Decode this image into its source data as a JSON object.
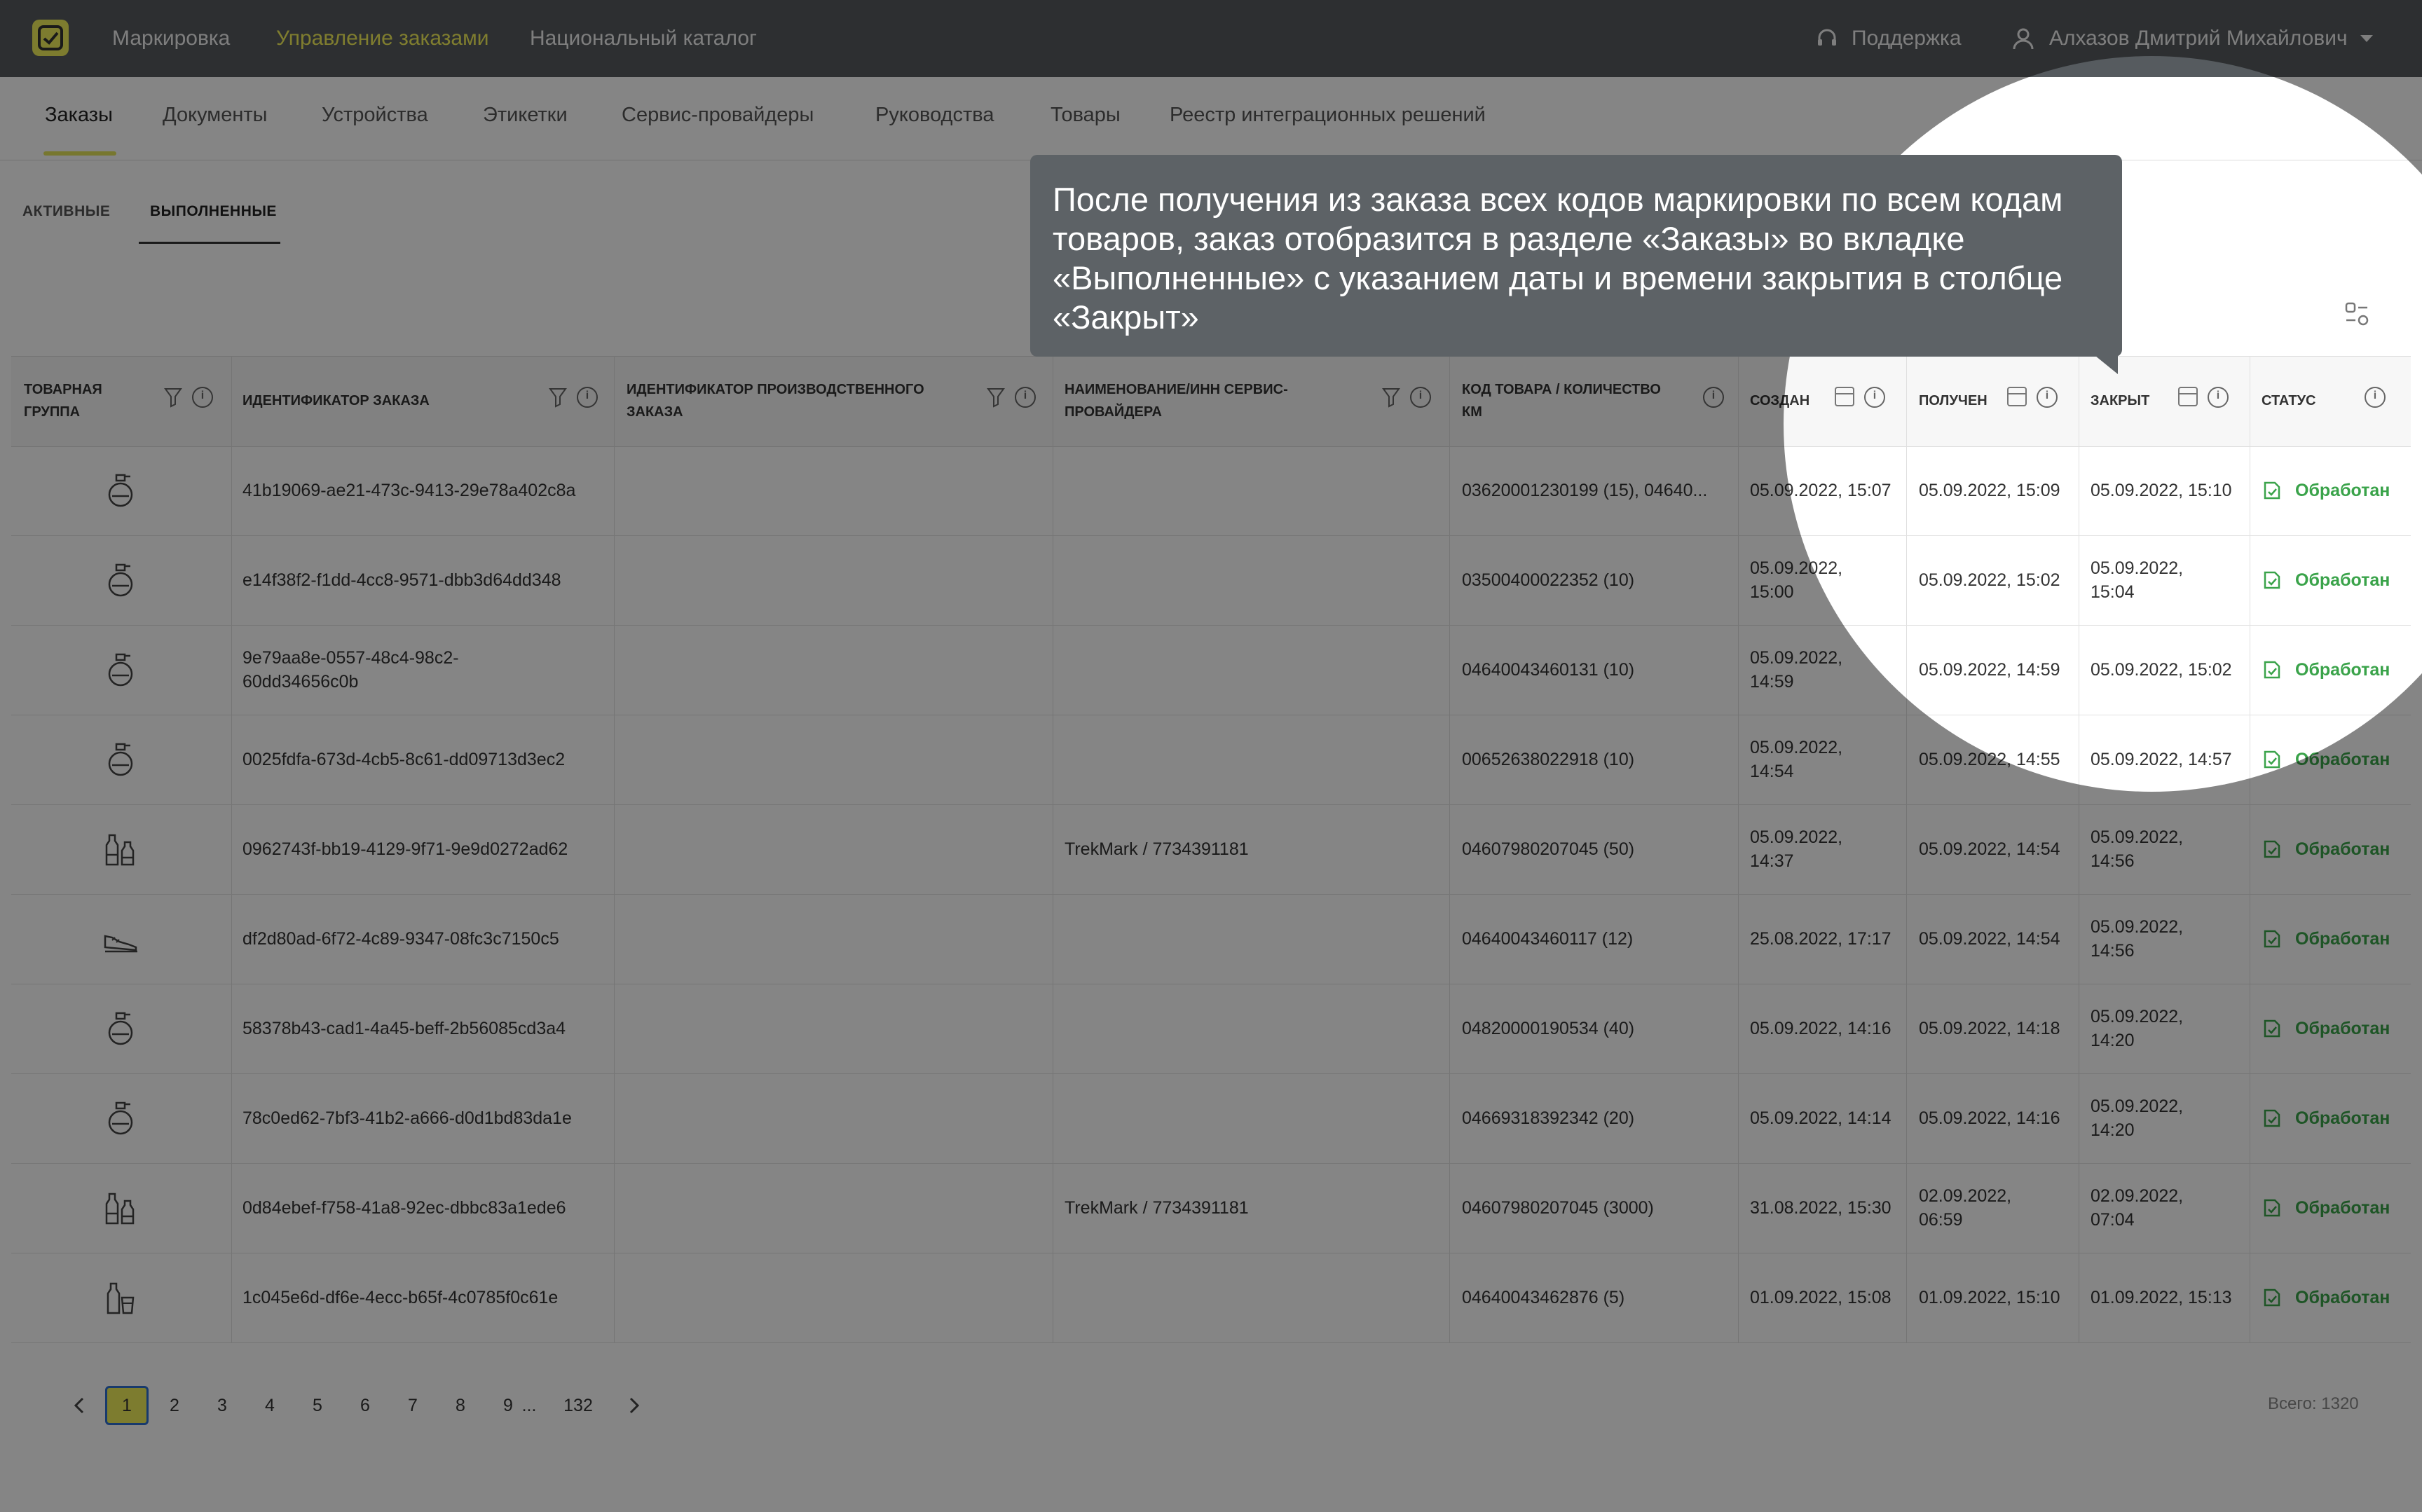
{
  "topbar": {
    "nav": [
      "Маркировка",
      "Управление заказами",
      "Национальный каталог"
    ],
    "support": "Поддержка",
    "user": "Алхазов Дмитрий Михайлович",
    "active_color": "#f3f05a"
  },
  "secnav": [
    "Заказы",
    "Документы",
    "Устройства",
    "Этикетки",
    "Сервис-провайдеры",
    "Руководства",
    "Товары",
    "Реестр интеграционных решений"
  ],
  "subtabs": [
    "АКТИВНЫЕ",
    "ВЫПОЛНЕННЫЕ"
  ],
  "tooltip": "После получения из заказа всех кодов маркировки по всем кодам товаров, заказ отобразится в разделе «Заказы» во вкладке «Выполненные» с указанием даты и времени закрытия в столбце «Закрыт»",
  "table": {
    "headers": {
      "group": [
        "ТОВАРНАЯ",
        "ГРУППА"
      ],
      "order_id": "ИДЕНТИФИКАТОР ЗАКАЗА",
      "prod_id": [
        "ИДЕНТИФИКАТОР ПРОИЗВОДСТВЕННОГО",
        "ЗАКАЗА"
      ],
      "provider": [
        "НАИМЕНОВАНИЕ/ИНН СЕРВИС-",
        "ПРОВАЙДЕРА"
      ],
      "code": [
        "КОД ТОВАРА / КОЛИЧЕСТВО",
        "КМ"
      ],
      "created": "СОЗДАН",
      "received": "ПОЛУЧЕН",
      "closed": "ЗАКРЫТ",
      "status": "СТАТУС"
    },
    "rows": [
      {
        "icon": "perfume-icon",
        "id": [
          "41b19069-ae21-473c-9413-29e78a402c8a"
        ],
        "provider": "",
        "code": "03620001230199 (15), 04640...",
        "created": [
          "05.09.2022, 15:07"
        ],
        "received": [
          "05.09.2022, 15:09"
        ],
        "closed": [
          "05.09.2022, 15:10"
        ],
        "status": "Обработан"
      },
      {
        "icon": "perfume-icon",
        "id": [
          "e14f38f2-f1dd-4cc8-9571-dbb3d64dd348"
        ],
        "provider": "",
        "code": "03500400022352 (10)",
        "created": [
          "05.09.2022,",
          "15:00"
        ],
        "received": [
          "05.09.2022, 15:02"
        ],
        "closed": [
          "05.09.2022,",
          "15:04"
        ],
        "status": "Обработан"
      },
      {
        "icon": "perfume-icon",
        "id": [
          "9e79aa8e-0557-48c4-98c2-",
          "60dd34656c0b"
        ],
        "provider": "",
        "code": "04640043460131 (10)",
        "created": [
          "05.09.2022,",
          "14:59"
        ],
        "received": [
          "05.09.2022, 14:59"
        ],
        "closed": [
          "05.09.2022, 15:02"
        ],
        "status": "Обработан"
      },
      {
        "icon": "perfume-icon",
        "id": [
          "0025fdfa-673d-4cb5-8c61-dd09713d3ec2"
        ],
        "provider": "",
        "code": "00652638022918 (10)",
        "created": [
          "05.09.2022,",
          "14:54"
        ],
        "received": [
          "05.09.2022, 14:55"
        ],
        "closed": [
          "05.09.2022, 14:57"
        ],
        "status": "Обработан"
      },
      {
        "icon": "bottles-icon",
        "id": [
          "0962743f-bb19-4129-9f71-9e9d0272ad62"
        ],
        "provider": "TrekMark / 7734391181",
        "code": "04607980207045 (50)",
        "created": [
          "05.09.2022,",
          "14:37"
        ],
        "received": [
          "05.09.2022, 14:54"
        ],
        "closed": [
          "05.09.2022,",
          "14:56"
        ],
        "status": "Обработан"
      },
      {
        "icon": "shoe-icon",
        "id": [
          "df2d80ad-6f72-4c89-9347-08fc3c7150c5"
        ],
        "provider": "",
        "code": "04640043460117 (12)",
        "created": [
          "25.08.2022, 17:17"
        ],
        "received": [
          "05.09.2022, 14:54"
        ],
        "closed": [
          "05.09.2022,",
          "14:56"
        ],
        "status": "Обработан"
      },
      {
        "icon": "perfume-icon",
        "id": [
          "58378b43-cad1-4a45-beff-2b56085cd3a4"
        ],
        "provider": "",
        "code": "04820000190534 (40)",
        "created": [
          "05.09.2022, 14:16"
        ],
        "received": [
          "05.09.2022, 14:18"
        ],
        "closed": [
          "05.09.2022,",
          "14:20"
        ],
        "status": "Обработан"
      },
      {
        "icon": "perfume-icon",
        "id": [
          "78c0ed62-7bf3-41b2-a666-d0d1bd83da1e"
        ],
        "provider": "",
        "code": "04669318392342 (20)",
        "created": [
          "05.09.2022, 14:14"
        ],
        "received": [
          "05.09.2022, 14:16"
        ],
        "closed": [
          "05.09.2022,",
          "14:20"
        ],
        "status": "Обработан"
      },
      {
        "icon": "bottles-icon",
        "id": [
          "0d84ebef-f758-41a8-92ec-dbbc83a1ede6"
        ],
        "provider": "TrekMark / 7734391181",
        "code": "04607980207045 (3000)",
        "created": [
          "31.08.2022, 15:30"
        ],
        "received": [
          "02.09.2022,",
          "06:59"
        ],
        "closed": [
          "02.09.2022,",
          "07:04"
        ],
        "status": "Обработан"
      },
      {
        "icon": "drinks-icon",
        "id": [
          "1c045e6d-df6e-4ecc-b65f-4c0785f0c61e"
        ],
        "provider": "",
        "code": "04640043462876 (5)",
        "created": [
          "01.09.2022, 15:08"
        ],
        "received": [
          "01.09.2022, 15:10"
        ],
        "closed": [
          "01.09.2022, 15:13"
        ],
        "status": "Обработан"
      }
    ]
  },
  "pagination": {
    "pages": [
      "1",
      "2",
      "3",
      "4",
      "5",
      "6",
      "7",
      "8",
      "9"
    ],
    "ellipsis": "...",
    "last": "132",
    "current": "1",
    "total": "Всего: 1320"
  },
  "colors": {
    "brand": "#f0ee5a",
    "status": "#3aa34a",
    "dim": "rgba(0,0,0,0.48)"
  }
}
